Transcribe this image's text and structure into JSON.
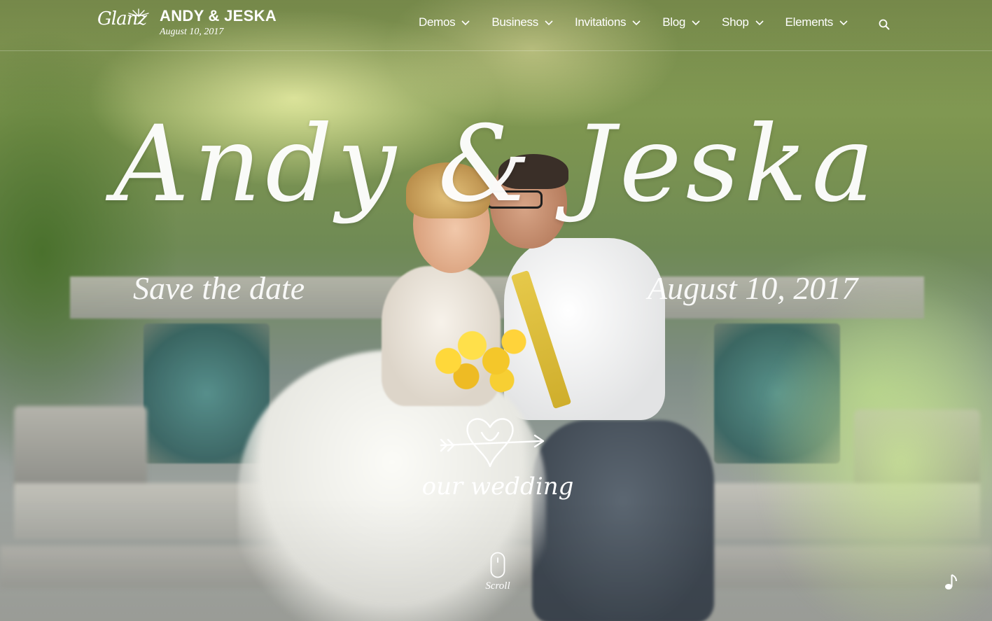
{
  "header": {
    "logo_text": "Glanz",
    "site_title": "ANDY & JESKA",
    "site_date": "August 10, 2017"
  },
  "nav": {
    "items": [
      {
        "label": "Demos"
      },
      {
        "label": "Business"
      },
      {
        "label": "Invitations"
      },
      {
        "label": "Blog"
      },
      {
        "label": "Shop"
      },
      {
        "label": "Elements"
      }
    ],
    "search_icon": "search-icon"
  },
  "hero": {
    "names": "Andy & Jeska",
    "save_the_date": "Save the date",
    "date": "August 10, 2017",
    "badge_text": "our wedding"
  },
  "footer_controls": {
    "scroll_label": "Scroll",
    "music_icon": "music-note-icon"
  },
  "colors": {
    "text": "#ffffff",
    "tie_yellow": "#e6c94a",
    "bouquet_yellow": "#ffd83a"
  }
}
